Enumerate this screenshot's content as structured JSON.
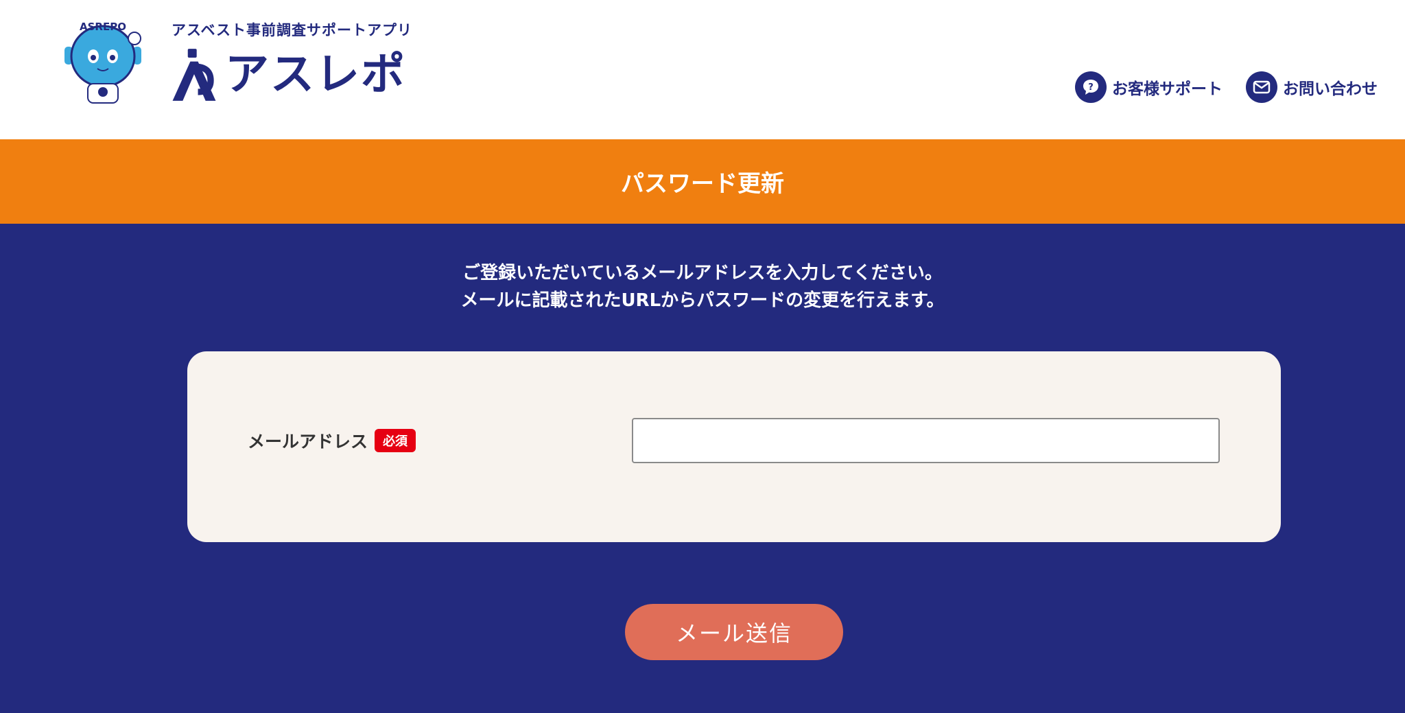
{
  "header": {
    "tagline": "アスベスト事前調査サポートアプリ",
    "logo_text": "アスレポ",
    "mascot_badge": "ASREPO",
    "nav": [
      {
        "label": "お客様サポート",
        "icon": "support-chat-icon"
      },
      {
        "label": "お問い合わせ",
        "icon": "mail-icon"
      }
    ]
  },
  "page": {
    "title": "パスワード更新",
    "intro_line1": "ご登録いただいているメールアドレスを入力してください。",
    "intro_line2": "メールに記載されたURLからパスワードの変更を行えます。"
  },
  "form": {
    "email_label": "メールアドレス",
    "required_badge": "必須",
    "email_value": "",
    "email_placeholder": "",
    "submit_label": "メール送信"
  },
  "colors": {
    "brand_navy": "#232a7e",
    "accent_orange": "#f07f10",
    "required_red": "#e60012",
    "button_coral": "#e06e58",
    "card_bg": "#f8f3ee"
  }
}
